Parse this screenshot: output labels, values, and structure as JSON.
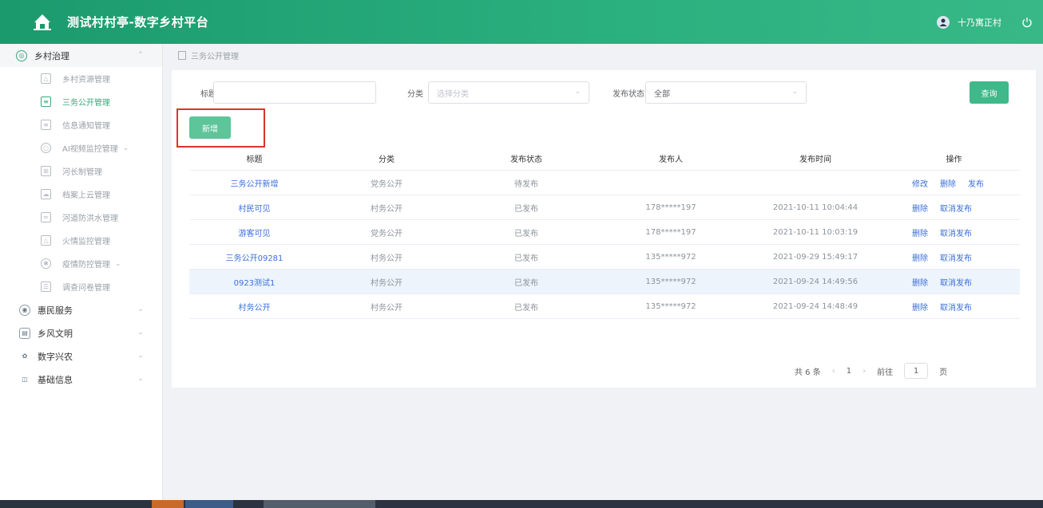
{
  "header": {
    "title": "测试村村亭-数字乡村平台",
    "username": "十乃寓正村"
  },
  "sidebar": {
    "top_menu": {
      "label": "乡村治理"
    },
    "sub_items": [
      {
        "label": "乡村资源管理",
        "active": false
      },
      {
        "label": "三务公开管理",
        "active": true
      },
      {
        "label": "信息通知管理",
        "active": false
      },
      {
        "label": "AI视频监控管理",
        "active": false,
        "has_chevron": true
      },
      {
        "label": "河长制管理",
        "active": false
      },
      {
        "label": "档案上云管理",
        "active": false
      },
      {
        "label": "河道防洪水管理",
        "active": false
      },
      {
        "label": "火情监控管理",
        "active": false
      },
      {
        "label": "疫情防控管理",
        "active": false,
        "has_chevron": true
      },
      {
        "label": "调查问卷管理",
        "active": false
      }
    ],
    "other_menus": [
      {
        "label": "惠民服务"
      },
      {
        "label": "乡风文明"
      },
      {
        "label": "数字兴农"
      },
      {
        "label": "基础信息"
      }
    ]
  },
  "breadcrumb": {
    "label": "三务公开管理"
  },
  "filters": {
    "title_label": "标题",
    "title_value": "",
    "category_label": "分类",
    "category_placeholder": "选择分类",
    "status_label": "发布状态",
    "status_value": "全部",
    "query_button": "查询",
    "add_button": "新增"
  },
  "table": {
    "columns": [
      "标题",
      "分类",
      "发布状态",
      "发布人",
      "发布时间",
      "操作"
    ],
    "rows": [
      {
        "title": "三务公开新增",
        "category": "党务公开",
        "status": "待发布",
        "publisher": "",
        "time": "",
        "ops": [
          "修改",
          "删除",
          "发布"
        ]
      },
      {
        "title": "村民可见",
        "category": "村务公开",
        "status": "已发布",
        "publisher": "178*****197",
        "time": "2021-10-11 10:04:44",
        "ops": [
          "删除",
          "取消发布"
        ]
      },
      {
        "title": "游客可见",
        "category": "党务公开",
        "status": "已发布",
        "publisher": "178*****197",
        "time": "2021-10-11 10:03:19",
        "ops": [
          "删除",
          "取消发布"
        ]
      },
      {
        "title": "三务公开09281",
        "category": "村务公开",
        "status": "已发布",
        "publisher": "135*****972",
        "time": "2021-09-29 15:49:17",
        "ops": [
          "删除",
          "取消发布"
        ]
      },
      {
        "title": "0923测试1",
        "category": "村务公开",
        "status": "已发布",
        "publisher": "135*****972",
        "time": "2021-09-24 14:49:56",
        "ops": [
          "删除",
          "取消发布"
        ],
        "highlighted": true
      },
      {
        "title": "村务公开",
        "category": "村务公开",
        "status": "已发布",
        "publisher": "135*****972",
        "time": "2021-09-24 14:48:49",
        "ops": [
          "删除",
          "取消发布"
        ]
      }
    ]
  },
  "pagination": {
    "total": "共 6 条",
    "current_page": "1",
    "goto_label": "前往",
    "goto_value": "1",
    "page_suffix": "页"
  },
  "colors": {
    "header": "#1b9a6e",
    "accent": "#3fb98a",
    "link": "#3a6fd8",
    "highlight_border": "#d9342b"
  }
}
